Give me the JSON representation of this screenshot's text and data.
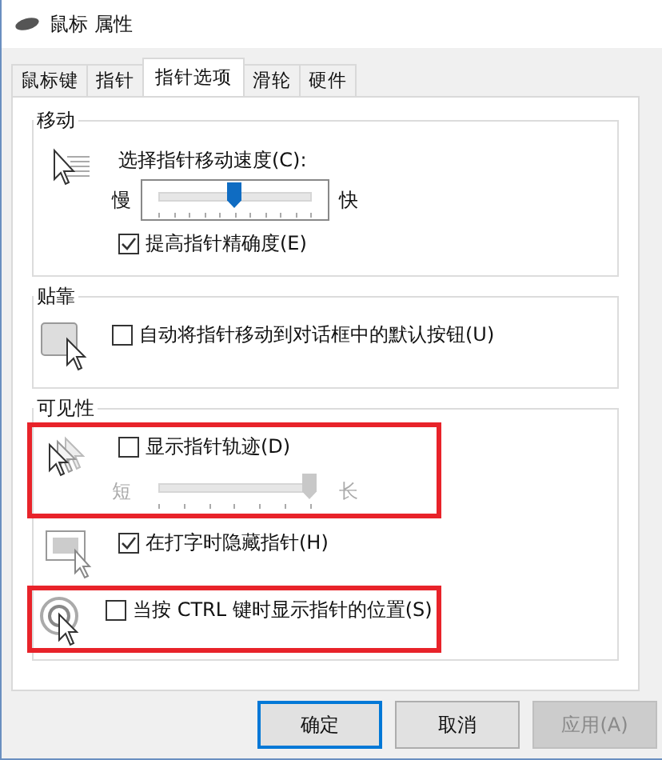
{
  "window": {
    "title": "鼠标 属性"
  },
  "tabs": [
    {
      "label": "鼠标键",
      "selected": false
    },
    {
      "label": "指针",
      "selected": false
    },
    {
      "label": "指针选项",
      "selected": true
    },
    {
      "label": "滑轮",
      "selected": false
    },
    {
      "label": "硬件",
      "selected": false
    }
  ],
  "groups": [
    {
      "title": "移动",
      "blocks": [
        {
          "highlighted": false,
          "rows": [
            {
              "kind": "slider",
              "label": "选择指针移动速度(C):",
              "min_label": "慢",
              "max_label": "快",
              "level": 0.5,
              "disabled": false
            },
            {
              "kind": "checkbox",
              "label": "提高指针精确度(E)",
              "checked": true
            }
          ]
        }
      ]
    },
    {
      "title": "贴靠",
      "blocks": [
        {
          "highlighted": false,
          "rows": [
            {
              "kind": "checkbox",
              "label": "自动将指针移动到对话框中的默认按钮(U)",
              "checked": false
            }
          ]
        }
      ]
    },
    {
      "title": "可见性",
      "blocks": [
        {
          "highlighted": true,
          "rows": [
            {
              "kind": "checkbox",
              "label": "显示指针轨迹(D)",
              "checked": false
            },
            {
              "kind": "slider",
              "min_label": "短",
              "max_label": "长",
              "level": 1,
              "disabled": true
            }
          ]
        },
        {
          "highlighted": false,
          "rows": [
            {
              "kind": "checkbox",
              "label": "在打字时隐藏指针(H)",
              "checked": true
            }
          ]
        },
        {
          "highlighted": true,
          "rows": [
            {
              "kind": "checkbox",
              "label": "当按 CTRL 键时显示指针的位置(S)",
              "checked": false
            }
          ]
        }
      ]
    }
  ],
  "buttons": [
    {
      "label": "确定",
      "default": true,
      "disabled": false
    },
    {
      "label": "取消",
      "default": false,
      "disabled": false
    },
    {
      "label": "应用(A)",
      "default": false,
      "disabled": true
    }
  ]
}
